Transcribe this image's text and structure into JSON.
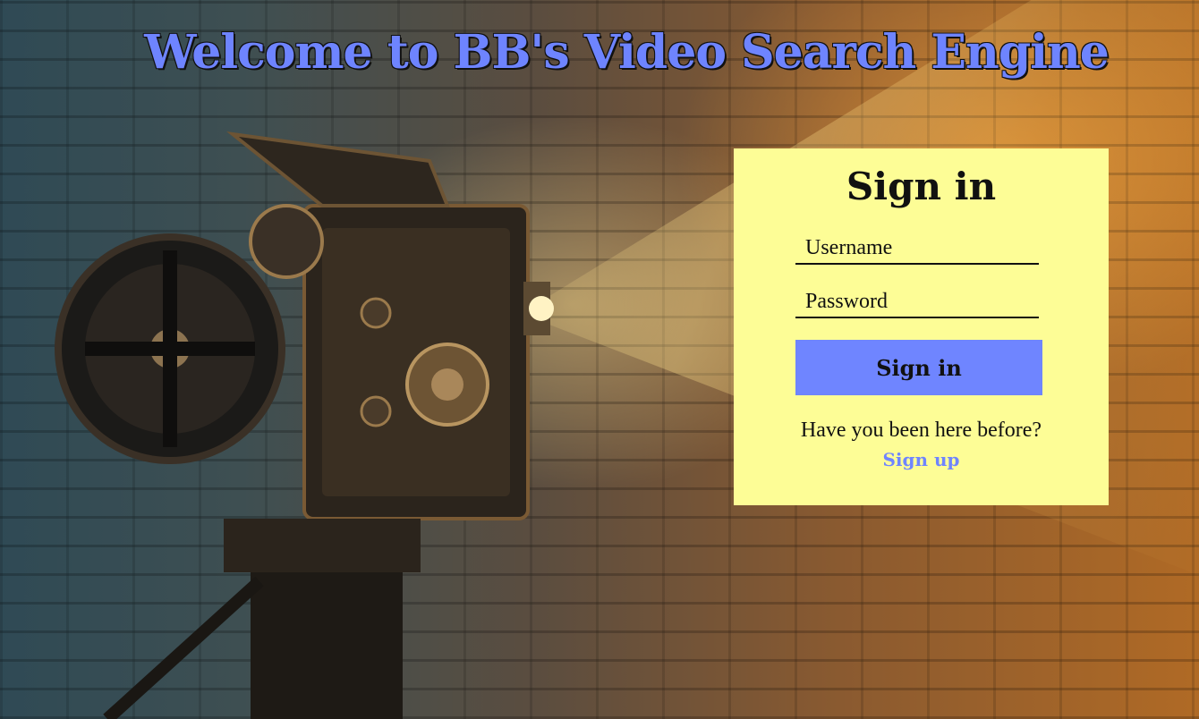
{
  "header": {
    "title": "Welcome to BB's Video Search Engine"
  },
  "background": {
    "image_subject": "vintage film projector in front of a brick wall"
  },
  "signin_card": {
    "title": "Sign in",
    "username_placeholder": "Username",
    "username_value": "",
    "password_placeholder": "Password",
    "password_value": "",
    "submit_label": "Sign in",
    "prompt_text": "Have you been here before?",
    "signup_label": "Sign up"
  },
  "colors": {
    "accent": "#6f85ff",
    "card_background": "#fdfd96",
    "text": "#111111"
  }
}
